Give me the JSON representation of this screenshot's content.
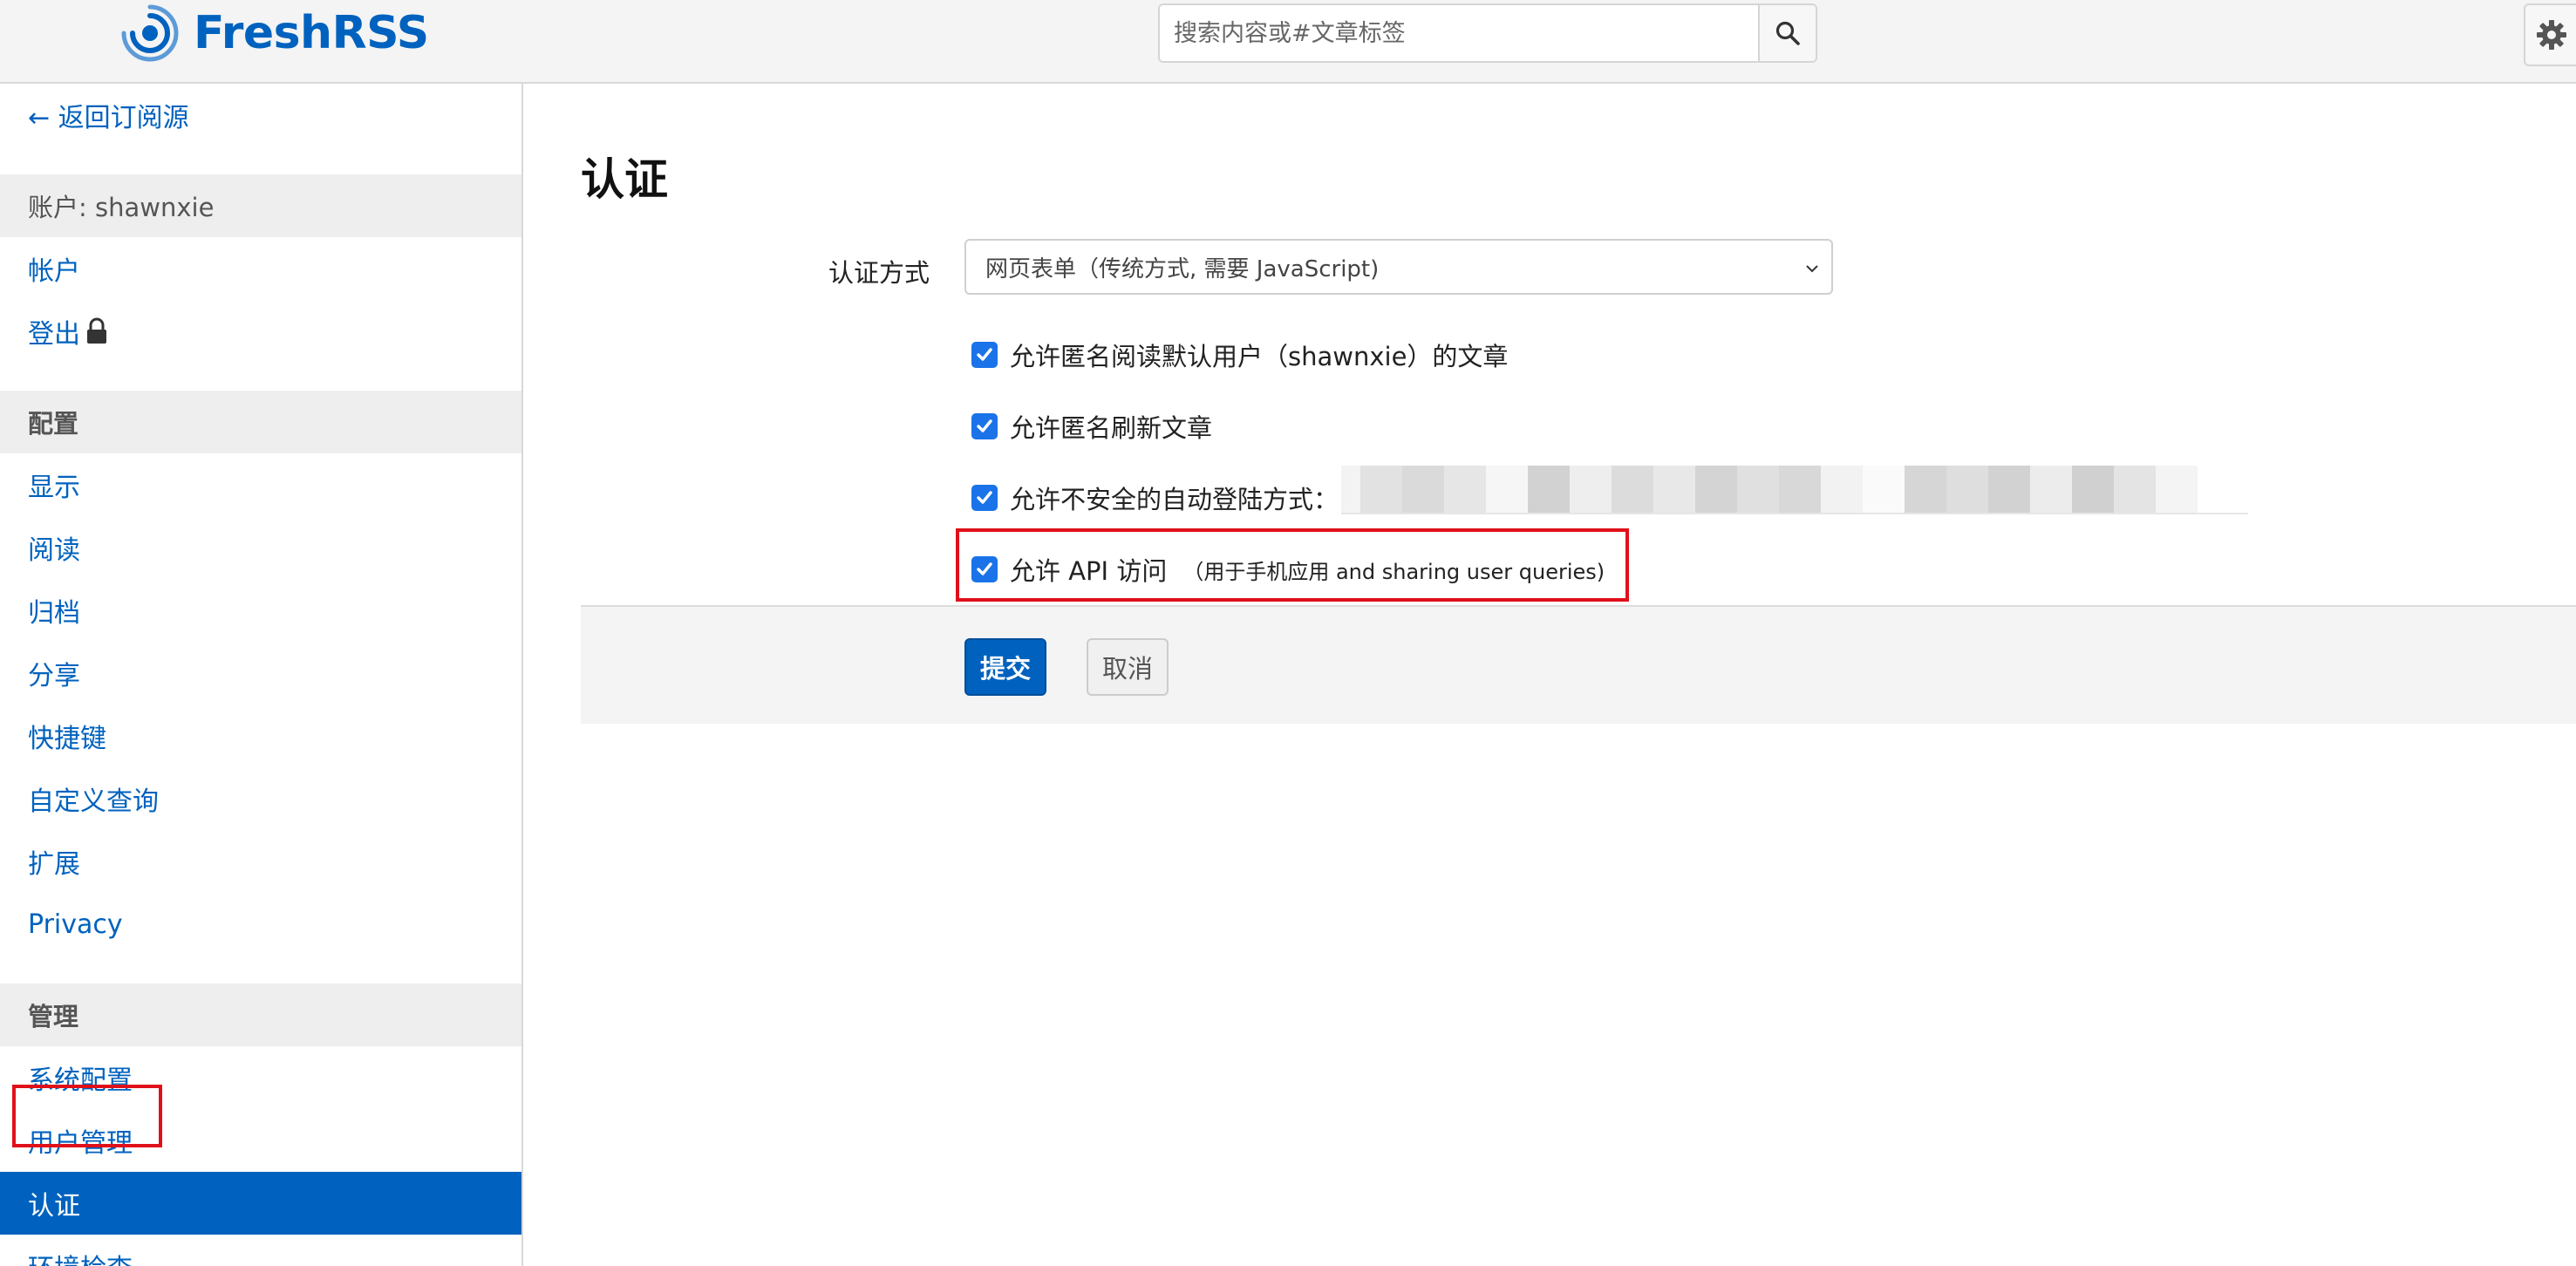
{
  "header": {
    "logo_text": "FreshRSS",
    "search": {
      "placeholder": "搜索内容或#文章标签",
      "value": ""
    }
  },
  "sidebar": {
    "back_link": "← 返回订阅源",
    "account_header": "账户: shawnxie",
    "account_items": [
      "帐户",
      "登出"
    ],
    "config_header": "配置",
    "config_items": [
      "显示",
      "阅读",
      "归档",
      "分享",
      "快捷键",
      "自定义查询",
      "扩展",
      "Privacy"
    ],
    "admin_header": "管理",
    "admin_items": [
      "系统配置",
      "用户管理",
      "认证",
      "环境检查"
    ],
    "active_item": "认证"
  },
  "main": {
    "title": "认证",
    "auth_method_label": "认证方式",
    "auth_method_value": "网页表单（传统方式, 需要 JavaScript)",
    "checkboxes": [
      {
        "label": "允许匿名阅读默认用户（shawnxie）的文章",
        "checked": true
      },
      {
        "label": "允许匿名刷新文章",
        "checked": true
      },
      {
        "label": "允许不安全的自动登陆方式：",
        "checked": true
      },
      {
        "label": "允许 API 访问",
        "sublabel": "（用于手机应用 and sharing user queries)",
        "checked": true
      }
    ],
    "submit_label": "提交",
    "cancel_label": "取消"
  },
  "colors": {
    "accent": "#0062be",
    "checkbox": "#1a73e8",
    "annotation": "#e0101a"
  }
}
